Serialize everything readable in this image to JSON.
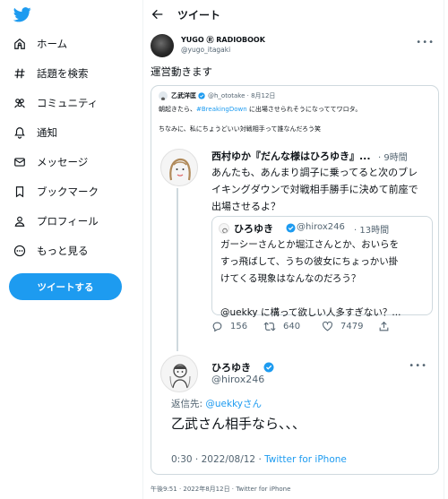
{
  "nav": {
    "home": "ホーム",
    "explore": "話題を検索",
    "communities": "コミュニティ",
    "notifications": "通知",
    "messages": "メッセージ",
    "bookmarks": "ブックマーク",
    "profile": "プロフィール",
    "more": "もっと見る",
    "tweet_button": "ツイートする"
  },
  "header": {
    "title": "ツイート"
  },
  "tweet": {
    "author_name": "YUGO Ⓡ RADIOBOOK",
    "author_handle": "@yugo_itagaki",
    "text": "運営動きます",
    "timestamp": "午後9:51 · 2022年8月12日 · Twitter for iPhone"
  },
  "quote": {
    "name": "乙武洋匡",
    "handle_time": "@h_ototake · 8月12日",
    "line1_pre": "朝起きたら、",
    "line1_tag": "#BreakingDown",
    "line1_post": " に出場させられそうになっててワロタ。",
    "line2": "ちなみに、私にちょうどいい対戦相手って誰なんだろう笑"
  },
  "thread": {
    "nishimura": {
      "name": "西村ゆか『だんな様はひろゆき』...",
      "time": "· 9時間",
      "lines": [
        "あんたも、あんまり調子に乗ってると次のブレ",
        "イキングダウンで対戦相手勝手に決めて前座で",
        "出場させるよ？"
      ]
    },
    "hiroyuki_quoted": {
      "name": "ひろゆき",
      "handle": "@hirox246",
      "time": "· 13時間",
      "lines": [
        "ガーシーさんとか堀江さんとか、おいらを",
        "すっ飛ばして、うちの彼女にちょっかい掛",
        "けてくる現象はなんなのだろう？",
        "",
        "@uekky に構って欲しい人多すぎない？..."
      ]
    },
    "actions": {
      "replies": "156",
      "retweets": "640",
      "likes": "7479"
    },
    "reply": {
      "name": "ひろゆき",
      "handle": "@hirox246",
      "reply_label": "返信先: ",
      "reply_target": "@uekkyさん",
      "text": "乙武さん相手なら、、、",
      "time": "0:30 · 2022/08/12 · ",
      "client": "Twitter for iPhone"
    }
  },
  "colors": {
    "accent": "#1d9bf0",
    "muted": "#536471",
    "border": "#cfd9de"
  },
  "icons": [
    "twitter-bird-icon",
    "home-icon",
    "hashtag-icon",
    "communities-icon",
    "bell-icon",
    "mail-icon",
    "bookmark-icon",
    "person-icon",
    "more-circle-icon",
    "back-arrow-icon",
    "verified-icon",
    "reply-icon",
    "retweet-icon",
    "like-icon",
    "share-icon",
    "more-dots-icon"
  ]
}
